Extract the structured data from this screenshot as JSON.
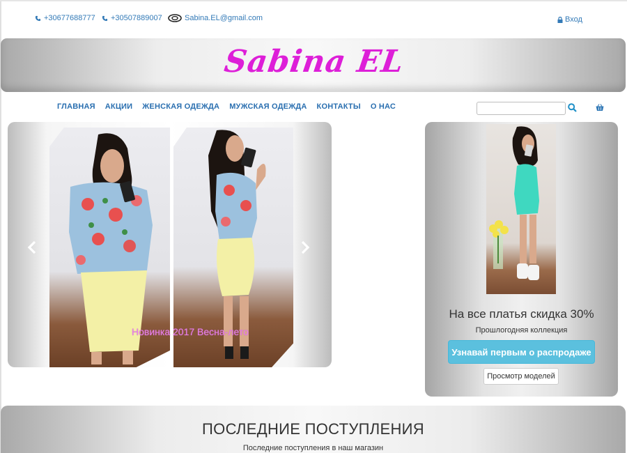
{
  "topbar": {
    "phone1": "+30677688777",
    "phone2": "+30507889007",
    "email": "Sabina.EL@gmail.com",
    "login_label": "Вход"
  },
  "brand": {
    "logo_text": "Sabina EL",
    "logo_color": "#dd1fd8"
  },
  "nav": {
    "items": [
      {
        "label": "ГЛАВНАЯ"
      },
      {
        "label": "АКЦИИ"
      },
      {
        "label": "ЖЕНСКАЯ ОДЕЖДА"
      },
      {
        "label": "МУЖСКАЯ ОДЕЖДА"
      },
      {
        "label": "КОНТАКТЫ"
      },
      {
        "label": "О НАС"
      }
    ]
  },
  "search": {
    "value": "",
    "placeholder": ""
  },
  "slider": {
    "caption": "Новинка 2017 Весна-лето"
  },
  "promo": {
    "title": "На все платья скидка 30%",
    "subtitle": "Прошлогодняя коллекция",
    "cta_label": "Узнавай первым о распродаже",
    "view_label": "Просмотр моделей"
  },
  "latest": {
    "title": "ПОСЛЕДНИЕ ПОСТУПЛЕНИЯ",
    "subtitle": "Последние поступления в наш магазин"
  },
  "colors": {
    "link": "#337ab7",
    "accent": "#5bc0de"
  }
}
